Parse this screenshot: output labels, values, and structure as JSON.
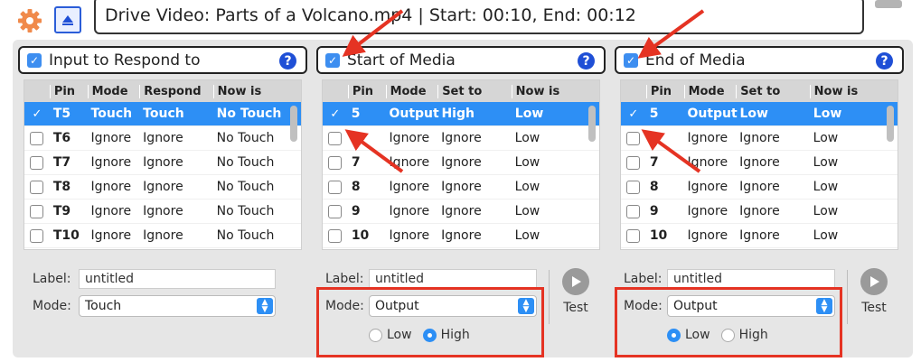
{
  "title": "Drive Video: Parts of a Volcano.mp4 | Start: 00:10, End: 00:12",
  "colors": {
    "accent": "#2d8ff5",
    "highlight": "#e53323",
    "gear": "#f08a4b"
  },
  "panels": [
    {
      "header": "Input to Respond to",
      "columns": [
        "Pin",
        "Mode",
        "Respond",
        "Now is"
      ],
      "rows": [
        {
          "pin": "T5",
          "mode": "Touch",
          "col3": "Touch",
          "now": "No Touch",
          "selected": true
        },
        {
          "pin": "T6",
          "mode": "Ignore",
          "col3": "Ignore",
          "now": "No Touch"
        },
        {
          "pin": "T7",
          "mode": "Ignore",
          "col3": "Ignore",
          "now": "No Touch"
        },
        {
          "pin": "T8",
          "mode": "Ignore",
          "col3": "Ignore",
          "now": "No Touch"
        },
        {
          "pin": "T9",
          "mode": "Ignore",
          "col3": "Ignore",
          "now": "No Touch"
        },
        {
          "pin": "T10",
          "mode": "Ignore",
          "col3": "Ignore",
          "now": "No Touch"
        }
      ],
      "label_caption": "Label:",
      "label_value": "untitled",
      "mode_caption": "Mode:",
      "mode_value": "Touch"
    },
    {
      "header": "Start of Media",
      "columns": [
        "Pin",
        "Mode",
        "Set to",
        "Now is"
      ],
      "rows": [
        {
          "pin": "5",
          "mode": "Output",
          "col3": "High",
          "now": "Low",
          "selected": true
        },
        {
          "pin": "6",
          "mode": "Ignore",
          "col3": "Ignore",
          "now": "Low"
        },
        {
          "pin": "7",
          "mode": "Ignore",
          "col3": "Ignore",
          "now": "Low"
        },
        {
          "pin": "8",
          "mode": "Ignore",
          "col3": "Ignore",
          "now": "Low"
        },
        {
          "pin": "9",
          "mode": "Ignore",
          "col3": "Ignore",
          "now": "Low"
        },
        {
          "pin": "10",
          "mode": "Ignore",
          "col3": "Ignore",
          "now": "Low"
        }
      ],
      "label_caption": "Label:",
      "label_value": "untitled",
      "mode_caption": "Mode:",
      "mode_value": "Output",
      "radio_low": "Low",
      "radio_high": "High",
      "radio_selected": "High",
      "test_label": "Test"
    },
    {
      "header": "End of Media",
      "columns": [
        "Pin",
        "Mode",
        "Set to",
        "Now is"
      ],
      "rows": [
        {
          "pin": "5",
          "mode": "Output",
          "col3": "Low",
          "now": "Low",
          "selected": true
        },
        {
          "pin": "6",
          "mode": "Ignore",
          "col3": "Ignore",
          "now": "Low"
        },
        {
          "pin": "7",
          "mode": "Ignore",
          "col3": "Ignore",
          "now": "Low"
        },
        {
          "pin": "8",
          "mode": "Ignore",
          "col3": "Ignore",
          "now": "Low"
        },
        {
          "pin": "9",
          "mode": "Ignore",
          "col3": "Ignore",
          "now": "Low"
        },
        {
          "pin": "10",
          "mode": "Ignore",
          "col3": "Ignore",
          "now": "Low"
        }
      ],
      "label_caption": "Label:",
      "label_value": "untitled",
      "mode_caption": "Mode:",
      "mode_value": "Output",
      "radio_low": "Low",
      "radio_high": "High",
      "radio_selected": "Low",
      "test_label": "Test"
    }
  ]
}
